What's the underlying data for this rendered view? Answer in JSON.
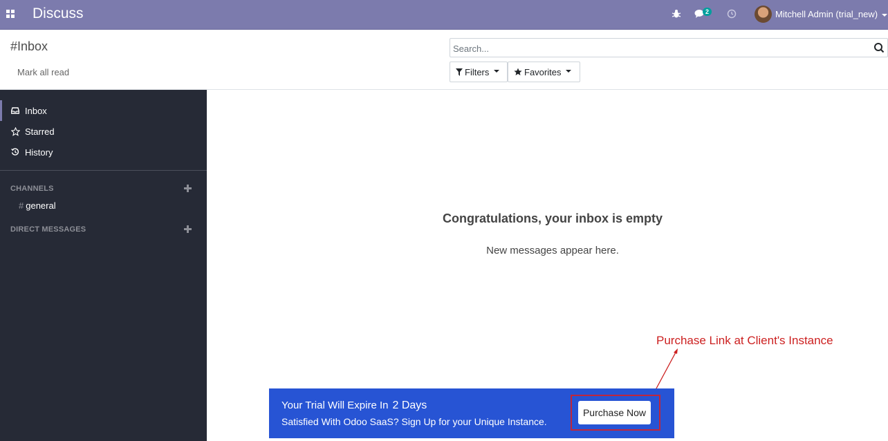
{
  "navbar": {
    "app_title": "Discuss",
    "chat_badge": "2",
    "user_name": "Mitchell Admin (trial_new)"
  },
  "control_panel": {
    "breadcrumb": "#Inbox",
    "mark_all_read": "Mark all read",
    "search_placeholder": "Search...",
    "filters_label": "Filters",
    "favorites_label": "Favorites"
  },
  "sidebar": {
    "items": [
      {
        "label": "Inbox",
        "icon": "inbox-icon"
      },
      {
        "label": "Starred",
        "icon": "star-icon"
      },
      {
        "label": "History",
        "icon": "history-icon"
      }
    ],
    "channels_header": "CHANNELS",
    "channels": [
      {
        "label": "general"
      }
    ],
    "direct_messages_header": "DIRECT MESSAGES"
  },
  "main": {
    "empty_title": "Congratulations, your inbox is empty",
    "empty_subtitle": "New messages appear here."
  },
  "annotation": {
    "text": "Purchase Link at Client's Instance",
    "color": "#cc1f1f"
  },
  "trial_banner": {
    "line1": "Your Trial Will Expire In",
    "days": "2 Days",
    "line2": "Satisfied With Odoo SaaS? Sign Up for your Unique Instance.",
    "button_label": "Purchase Now",
    "background": "#2754d4"
  },
  "colors": {
    "navbar": "#7c7bad",
    "sidebar": "#262a36",
    "badge": "#00a09d"
  }
}
